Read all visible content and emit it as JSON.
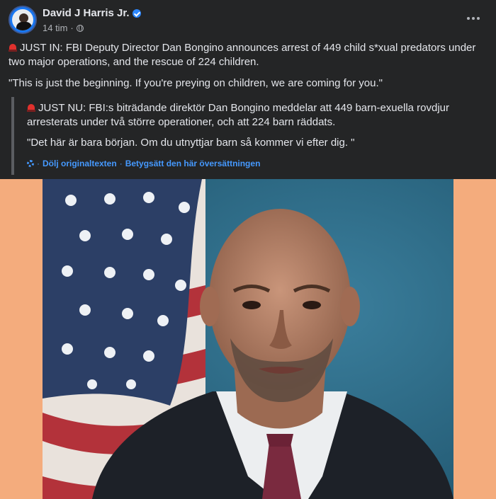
{
  "header": {
    "author": "David J Harris Jr.",
    "time": "14 tim",
    "dot": "·"
  },
  "post": {
    "line1": "JUST IN: FBI Deputy Director Dan Bongino announces arrest of 449 child s*xual predators under two major operations, and the rescue of 224 children.",
    "line2": "\"This is just the beginning. If you're preying on children, we are coming for you.\""
  },
  "translation": {
    "line1": "JUST NU: FBI:s biträdande direktör Dan Bongino meddelar att 449 barn-exuella rovdjur arresterats under två större operationer, och att 224 barn räddats.",
    "line2": "\"Det här är bara början. Om du utnyttjar barn så kommer vi efter dig. \"",
    "hide_original": "Dölj originaltexten",
    "rate_translation": "Betygsätt den här översättningen",
    "sep": "·"
  },
  "colors": {
    "background": "#242526",
    "link": "#4599ff",
    "image_matte": "#f4ac7d",
    "photo_background": "#2f6c8a"
  },
  "icons": {
    "verified": "verified-badge-icon",
    "privacy": "globe-icon",
    "menu": "more-horizontal-icon",
    "siren": "siren-emoji-icon",
    "translate": "translate-gear-icon"
  }
}
